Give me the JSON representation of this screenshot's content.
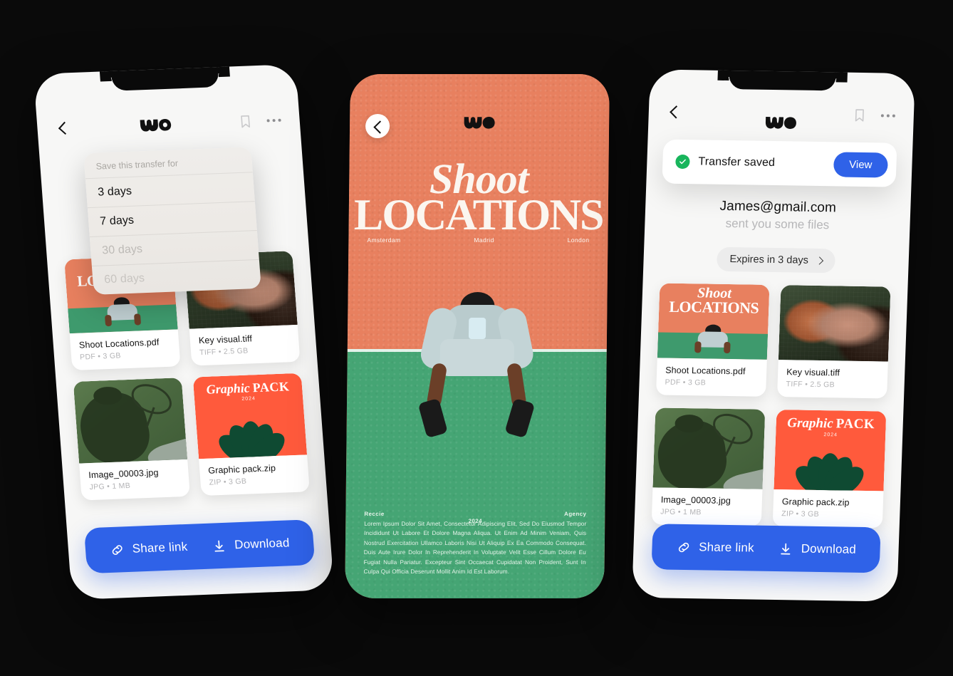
{
  "background_color": "#0A0A0A",
  "brand": {
    "logo_name": "wetransfer-we-logo",
    "blue": "#2F62E8",
    "orange": "#E8805F",
    "green": "#45A574",
    "pack_orange": "#FF5A3C",
    "pack_green": "#0F4A32",
    "success_green": "#18B55C"
  },
  "phone_left": {
    "topbar": {
      "back_icon": "chevron-left-icon",
      "logo": "we-logo",
      "bookmark_icon": "bookmark-icon",
      "more_icon": "more-dots-icon"
    },
    "dropdown": {
      "header": "Save this transfer for",
      "options": [
        {
          "label": "3 days",
          "state": "active"
        },
        {
          "label": "7 days",
          "state": "active"
        },
        {
          "label": "30 days",
          "state": "dim"
        },
        {
          "label": "60 days",
          "state": "dim"
        }
      ]
    },
    "files": [
      {
        "name": "Shoot Locations.pdf",
        "meta": "PDF  •  3 GB",
        "thumb": "poster-thumb"
      },
      {
        "name": "Key visual.tiff",
        "meta": "TIFF  •  2.5 GB",
        "thumb": "faces-photo-thumb"
      },
      {
        "name": "Image_00003.jpg",
        "meta": "JPG  •  1 MB",
        "thumb": "tennis-shadow-thumb"
      },
      {
        "name": "Graphic pack.zip",
        "meta": "ZIP  •  3 GB",
        "thumb": "graphic-pack-thumb"
      }
    ],
    "actions": {
      "share_label": "Share link",
      "share_icon": "link-icon",
      "download_label": "Download",
      "download_icon": "download-icon"
    }
  },
  "phone_center": {
    "back_icon": "chevron-left-icon",
    "logo": "we-logo",
    "poster": {
      "title_line1": "Shoot",
      "title_line2": "LOCATIONS",
      "cities": [
        "Amsterdam",
        "Madrid",
        "London"
      ],
      "footer_left": "Reccie",
      "footer_center": "2024",
      "footer_right": "Agency",
      "footer_body": "Lorem Ipsum Dolor Sit Amet, Consectetur Adipiscing Elit, Sed Do Eiusmod Tempor Incididunt Ut Labore Et Dolore Magna Aliqua. Ut Enim Ad Minim Veniam, Quis Nostrud Exercitation Ullamco Laboris Nisi Ut Aliquip Ex Ea Commodo Consequat. Duis Aute Irure Dolor In Reprehenderit In Voluptate Velit Esse Cillum Dolore Eu Fugiat Nulla Pariatur. Excepteur Sint Occaecat Cupidatat Non Proident, Sunt In Culpa Qui Officia Deserunt Mollit Anim Id Est Laborum."
    }
  },
  "phone_right": {
    "topbar": {
      "back_icon": "chevron-left-icon",
      "logo": "we-logo",
      "bookmark_icon": "bookmark-icon",
      "more_icon": "more-dots-icon"
    },
    "toast": {
      "status_icon": "check-circle-icon",
      "message": "Transfer saved",
      "action_label": "View"
    },
    "sender": {
      "email": "James@gmail.com",
      "subtitle": "sent you some files"
    },
    "expires": {
      "label": "Expires in 3 days",
      "chevron_icon": "chevron-right-icon"
    },
    "files": [
      {
        "name": "Shoot Locations.pdf",
        "meta": "PDF  •  3 GB",
        "thumb": "poster-thumb"
      },
      {
        "name": "Key visual.tiff",
        "meta": "TIFF  •  2.5 GB",
        "thumb": "faces-photo-thumb"
      },
      {
        "name": "Image_00003.jpg",
        "meta": "JPG  •  1 MB",
        "thumb": "tennis-shadow-thumb"
      },
      {
        "name": "Graphic pack.zip",
        "meta": "ZIP  •  3 GB",
        "thumb": "graphic-pack-thumb"
      }
    ],
    "actions": {
      "share_label": "Share link",
      "share_icon": "link-icon",
      "download_label": "Download",
      "download_icon": "download-icon"
    }
  },
  "thumbs": {
    "poster": {
      "line1": "Shoot",
      "line2": "LOCATIONS",
      "year": "2024"
    },
    "pack": {
      "italic": "Graphic",
      "bold": "PACK",
      "year": "2024"
    }
  }
}
